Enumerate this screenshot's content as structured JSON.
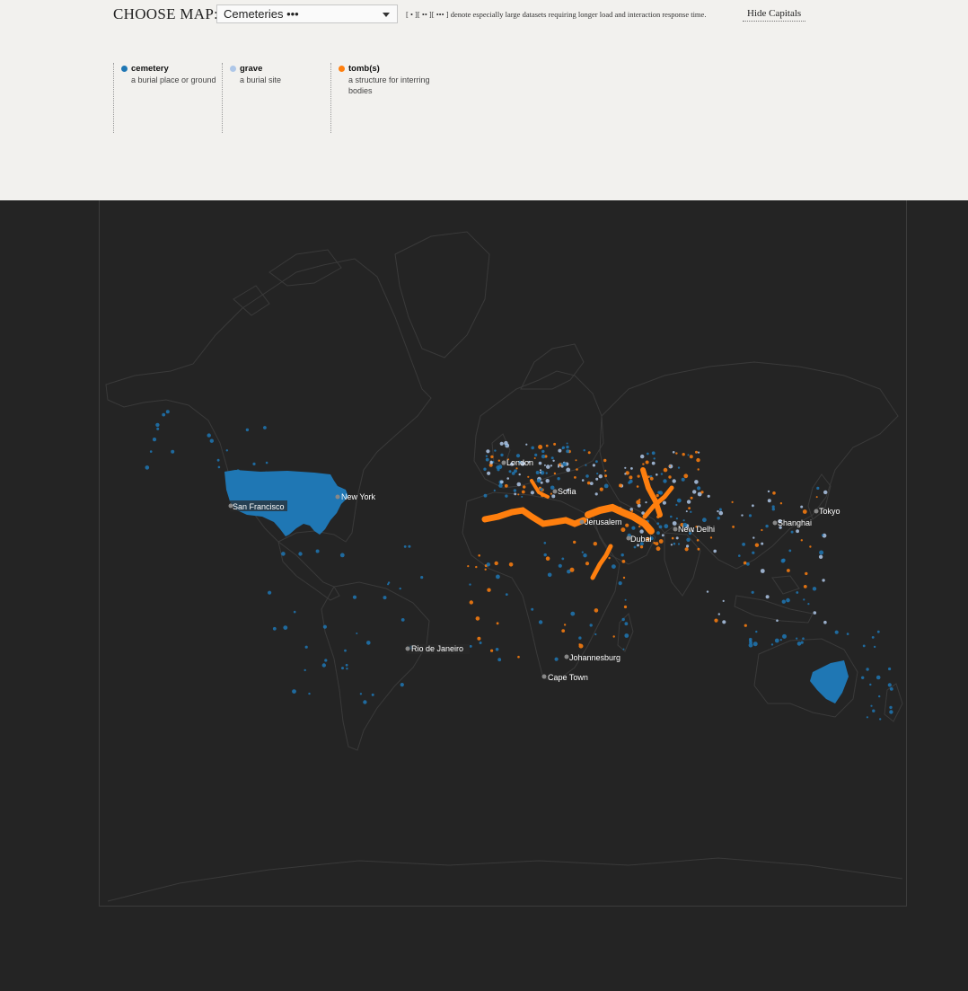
{
  "header": {
    "choose_label": "CHOOSE MAP:",
    "selected_map": "Cemeteries •••",
    "note": "[ • ][ •• ][ ••• ] denote especially large datasets requiring longer load and interaction response time.",
    "hide_capitals_label": "Hide Capitals"
  },
  "legend": [
    {
      "name": "cemetery",
      "desc": "a burial place or ground",
      "color": "#1f77b4"
    },
    {
      "name": "grave",
      "desc": "a burial site",
      "color": "#aec7e8"
    },
    {
      "name": "tomb(s)",
      "desc": "a structure for interring bodies",
      "color": "#ff7f0e"
    }
  ],
  "colors": {
    "map_background": "#242424",
    "page_background": "#f2f1ee",
    "coastline": "#3a3a3a",
    "city_dot": "#888888",
    "city_label": "#ffffff"
  },
  "cities": [
    {
      "name": "London"
    },
    {
      "name": "Sofia"
    },
    {
      "name": "New York"
    },
    {
      "name": "San Francisco"
    },
    {
      "name": "Jerusalem"
    },
    {
      "name": "Dubai"
    },
    {
      "name": "New Delhi"
    },
    {
      "name": "Shanghai"
    },
    {
      "name": "Tokyo"
    },
    {
      "name": "Rio de Janeiro"
    },
    {
      "name": "Johannesburg"
    },
    {
      "name": "Cape Town"
    }
  ]
}
